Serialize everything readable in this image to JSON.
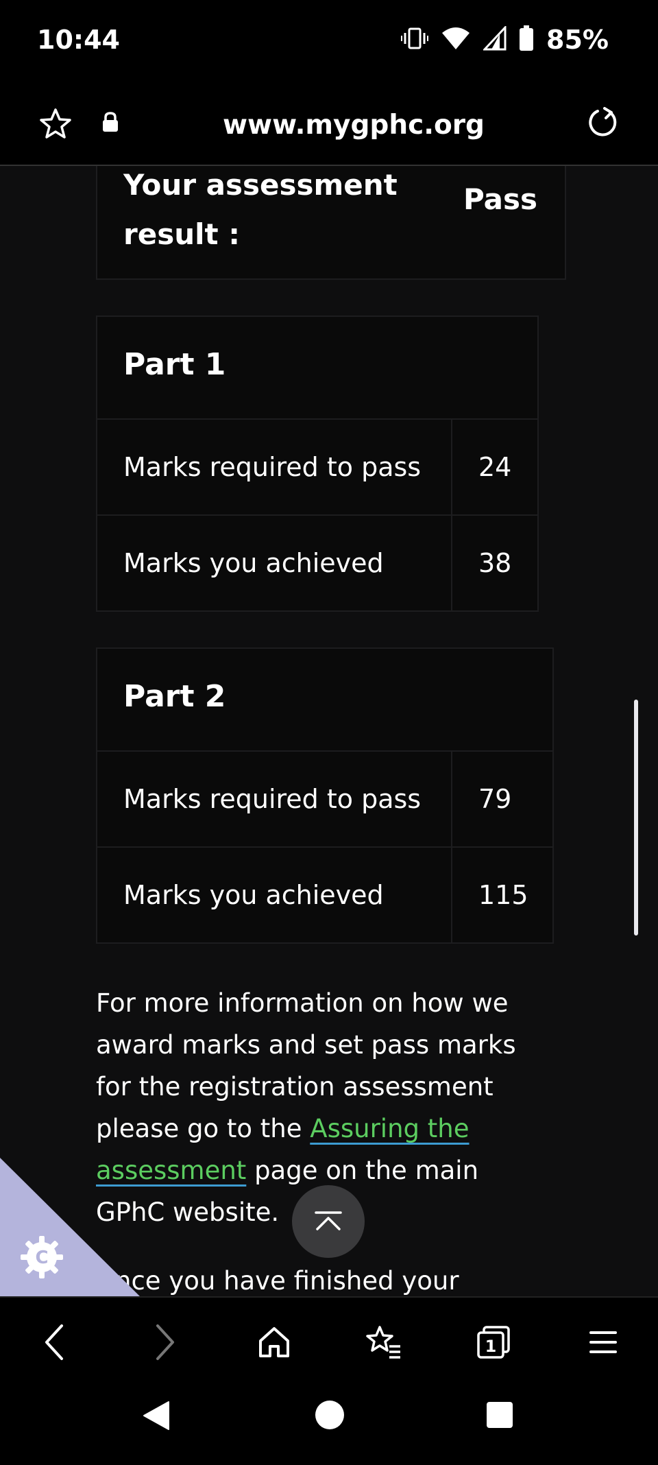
{
  "status_bar": {
    "time": "10:44",
    "battery_percent": "85%"
  },
  "browser": {
    "url": "www.mygphc.org"
  },
  "result": {
    "label": "Your assessment result :",
    "value": "Pass"
  },
  "parts": [
    {
      "title": "Part 1",
      "rows": [
        {
          "label": "Marks required to pass",
          "value": "24"
        },
        {
          "label": "Marks you achieved",
          "value": "38"
        }
      ]
    },
    {
      "title": "Part 2",
      "rows": [
        {
          "label": "Marks required to pass",
          "value": "79"
        },
        {
          "label": "Marks you achieved",
          "value": "115"
        }
      ]
    }
  ],
  "info": {
    "text_before": "For more information on how we award marks and set pass marks for the registration assessment please go to the ",
    "link_text": "Assuring the assessment",
    "text_after": " page on the main GPhC website."
  },
  "cut_text": "nce you have finished your",
  "badge_letter": "C",
  "colors": {
    "link": "#5ccd60",
    "link_underline": "#3c9bd1",
    "page_bg": "#0e0e0f",
    "corner_triangle": "#b4b4dc"
  }
}
